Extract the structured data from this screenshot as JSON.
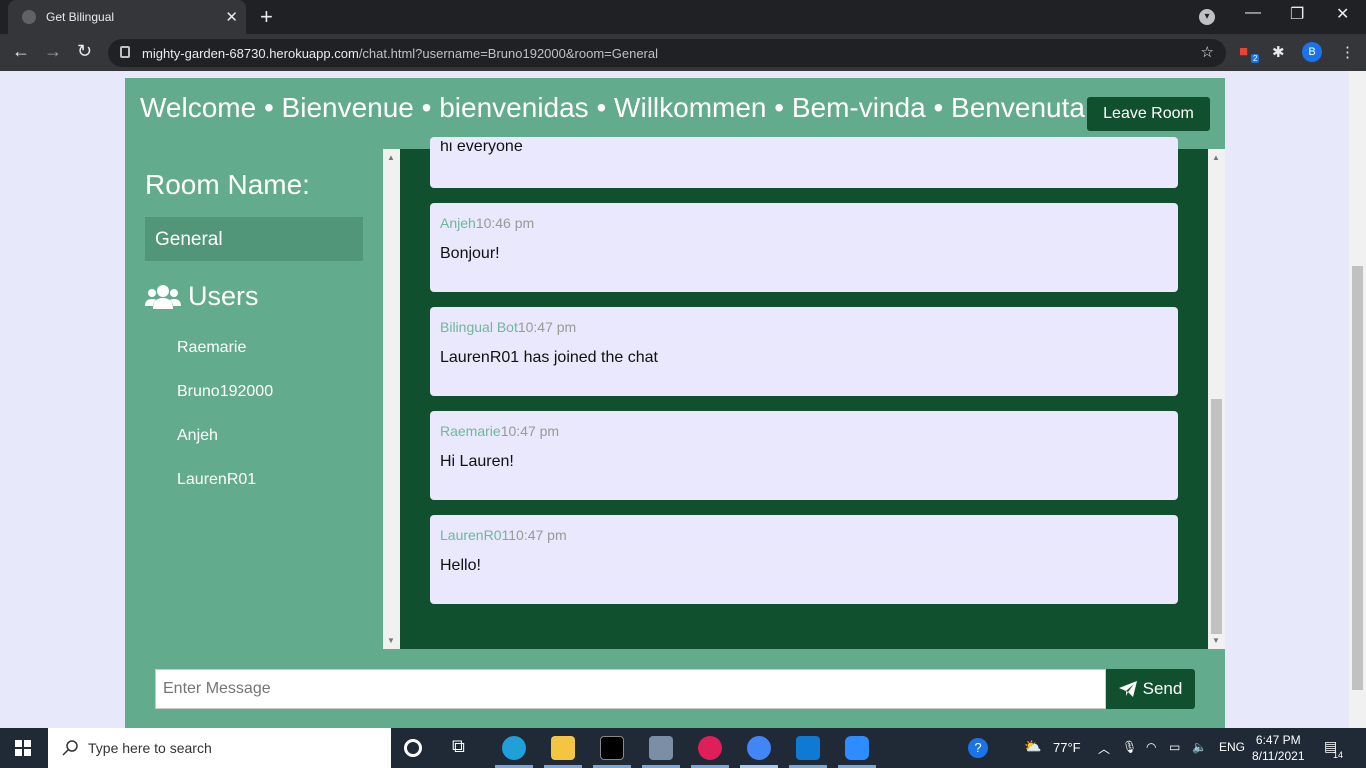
{
  "browser": {
    "tab_title": "Get Bilingual",
    "url_host": "mighty-garden-68730.herokuapp.com",
    "url_path": "/chat.html?username=Bruno192000&room=General",
    "extension_badge": "2",
    "profile_initial": "B"
  },
  "header": {
    "welcome": "Welcome • Bienvenue • bienvenidas • Willkommen • Bem-vinda • Benvenuta",
    "leave_label": "Leave Room"
  },
  "sidebar": {
    "room_heading": "Room Name:",
    "room_name": "General",
    "users_heading": "Users",
    "users": [
      "Raemarie",
      "Bruno192000",
      "Anjeh",
      "LaurenR01"
    ]
  },
  "messages": [
    {
      "author": "",
      "time": "",
      "text": "hi everyone"
    },
    {
      "author": "Anjeh",
      "time": "10:46 pm",
      "text": "Bonjour!"
    },
    {
      "author": "Bilingual Bot",
      "time": "10:47 pm",
      "text": "LaurenR01 has joined the chat"
    },
    {
      "author": "Raemarie",
      "time": "10:47 pm",
      "text": "Hi Lauren!"
    },
    {
      "author": "LaurenR01",
      "time": "10:47 pm",
      "text": "Hello!"
    }
  ],
  "composer": {
    "placeholder": "Enter Message",
    "send_label": "Send"
  },
  "taskbar": {
    "search_placeholder": "Type here to search",
    "weather": "77°F",
    "language": "ENG",
    "time": "6:47 PM",
    "date": "8/11/2021",
    "notifications": "14"
  },
  "colors": {
    "app_green": "#63ab8d",
    "dark_green": "#10502f",
    "message_bg": "#e9e8fc",
    "author_color": "#6fb79a"
  }
}
